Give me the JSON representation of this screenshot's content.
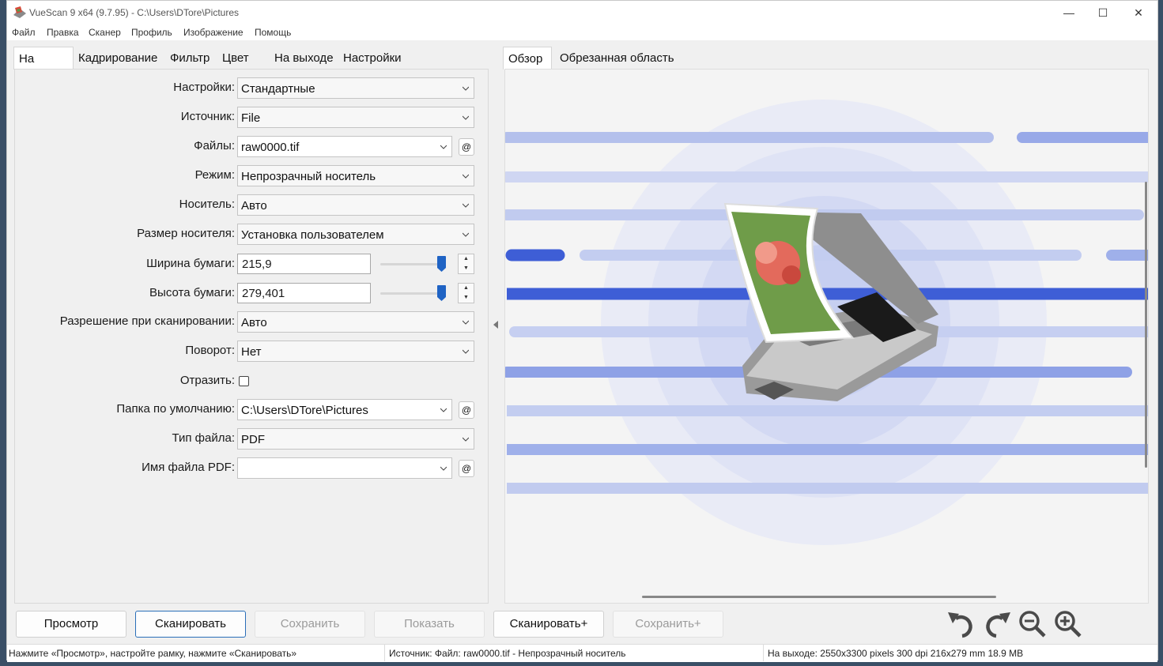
{
  "window": {
    "title": "VueScan 9 x64 (9.7.95) - C:\\Users\\DTore\\Pictures",
    "minimize_glyph": "—",
    "maximize_glyph": "☐",
    "close_glyph": "✕"
  },
  "menu": [
    "Файл",
    "Правка",
    "Сканер",
    "Профиль",
    "Изображение",
    "Помощь"
  ],
  "left_tabs": [
    "На входе",
    "Кадрирование",
    "Фильтр",
    "Цвет",
    "На выходе",
    "Настройки"
  ],
  "left_active_tab": "На входе",
  "form": {
    "settings": {
      "label": "Настройки:",
      "value": "Стандартные"
    },
    "source": {
      "label": "Источник:",
      "value": "File"
    },
    "files": {
      "label": "Файлы:",
      "value": "raw0000.tif",
      "at": "@"
    },
    "mode": {
      "label": "Режим:",
      "value": "Непрозрачный носитель"
    },
    "media": {
      "label": "Носитель:",
      "value": "Авто"
    },
    "media_size": {
      "label": "Размер носителя:",
      "value": "Установка пользователем"
    },
    "paper_width": {
      "label": "Ширина бумаги:",
      "value": "215,9"
    },
    "paper_height": {
      "label": "Высота бумаги:",
      "value": "279,401"
    },
    "resolution": {
      "label": "Разрешение при сканировании:",
      "value": "Авто"
    },
    "rotation": {
      "label": "Поворот:",
      "value": "Нет"
    },
    "mirror": {
      "label": "Отразить:",
      "checked": false
    },
    "default_folder": {
      "label": "Папка по умолчанию:",
      "value": "C:\\Users\\DTore\\Pictures",
      "at": "@"
    },
    "file_type": {
      "label": "Тип файла:",
      "value": "PDF"
    },
    "pdf_name": {
      "label": "Имя файла PDF:",
      "value": "",
      "at": "@"
    }
  },
  "spin_up": "▲",
  "spin_down": "▼",
  "right_tabs": [
    "Обзор",
    "Обрезанная область"
  ],
  "right_active_tab": "Обзор",
  "buttons": {
    "preview": "Просмотр",
    "scan": "Сканировать",
    "save": "Сохранить",
    "show": "Показать",
    "scan_plus": "Сканировать+",
    "save_plus": "Сохранить+"
  },
  "toolbar_icons": [
    "rotate-left-icon",
    "rotate-right-icon",
    "zoom-out-icon",
    "zoom-in-icon"
  ],
  "status": {
    "hint": "Нажмите «Просмотр», настройте рамку, нажмите «Сканировать»",
    "source": "Источник: Файл: raw0000.tif - Непрозрачный носитель",
    "output": "На выходе: 2550x3300 pixels 300 dpi 216x279 mm 18.9 MB"
  },
  "colors": {
    "accent": "#2a6fb8",
    "preview_band": "#3e5ed6",
    "preview_band_light": "#b8c4ee",
    "preview_circle": "#d9def5"
  }
}
